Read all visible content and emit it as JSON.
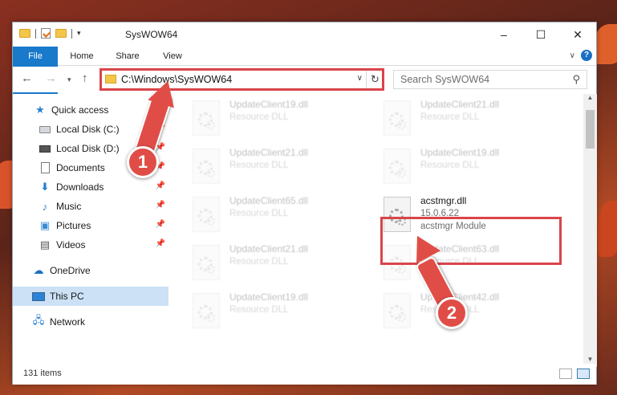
{
  "window": {
    "title": "SysWOW64",
    "controls": {
      "minimize": "–",
      "maximize": "☐",
      "close": "✕"
    }
  },
  "ribbon": {
    "tabs": [
      "File",
      "Home",
      "Share",
      "View"
    ],
    "help": "?"
  },
  "address_bar": {
    "path": "C:\\Windows\\SysWOW64",
    "refresh_icon": "↻"
  },
  "search": {
    "placeholder": "Search SysWOW64"
  },
  "nav_pane": {
    "items": [
      {
        "label": "Quick access",
        "icon": "star-icon",
        "pinned": false
      },
      {
        "label": "Local Disk (C:)",
        "icon": "drive-icon",
        "pinned": true
      },
      {
        "label": "Local Disk (D:)",
        "icon": "drive-icon",
        "pinned": true
      },
      {
        "label": "Documents",
        "icon": "documents-icon",
        "pinned": true
      },
      {
        "label": "Downloads",
        "icon": "downloads-icon",
        "pinned": true
      },
      {
        "label": "Music",
        "icon": "music-icon",
        "pinned": true
      },
      {
        "label": "Pictures",
        "icon": "pictures-icon",
        "pinned": true
      },
      {
        "label": "Videos",
        "icon": "videos-icon",
        "pinned": true
      },
      {
        "label": "OneDrive",
        "icon": "onedrive-icon",
        "pinned": false
      },
      {
        "label": "This PC",
        "icon": "this-pc-icon",
        "pinned": false,
        "selected": true
      },
      {
        "label": "Network",
        "icon": "network-icon",
        "pinned": false
      }
    ]
  },
  "files": [
    {
      "name": "UpdateClient19.dll",
      "line2": "Resource DLL",
      "line3": "",
      "faded": true
    },
    {
      "name": "UpdateClient21.dll",
      "line2": "Resource DLL",
      "line3": "",
      "faded": true
    },
    {
      "name": "UpdateClient21.dll",
      "line2": "Resource DLL",
      "line3": "",
      "faded": true
    },
    {
      "name": "UpdateClient19.dll",
      "line2": "Resource DLL",
      "line3": "",
      "faded": true
    },
    {
      "name": "UpdateClient65.dll",
      "line2": "Resource DLL",
      "line3": "",
      "faded": true
    },
    {
      "name": "acstmgr.dll",
      "line2": "15.0.6.22",
      "line3": "acstmgr Module",
      "faded": false
    },
    {
      "name": "UpdateClient21.dll",
      "line2": "Resource DLL",
      "line3": "",
      "faded": true
    },
    {
      "name": "UpdateClient63.dll",
      "line2": "Resource DLL",
      "line3": "",
      "faded": true
    },
    {
      "name": "UpdateClient19.dll",
      "line2": "Resource DLL",
      "line3": "",
      "faded": true
    },
    {
      "name": "UpdateClient42.dll",
      "line2": "Resource DLL",
      "line3": "",
      "faded": true
    }
  ],
  "status": {
    "item_count": "131 items"
  },
  "annotations": {
    "step1": "1",
    "step2": "2",
    "color": "#e04d47"
  },
  "colors": {
    "file_tab": "#1979ca",
    "highlight": "#d9454a",
    "selected_nav": "#cce1f5"
  }
}
